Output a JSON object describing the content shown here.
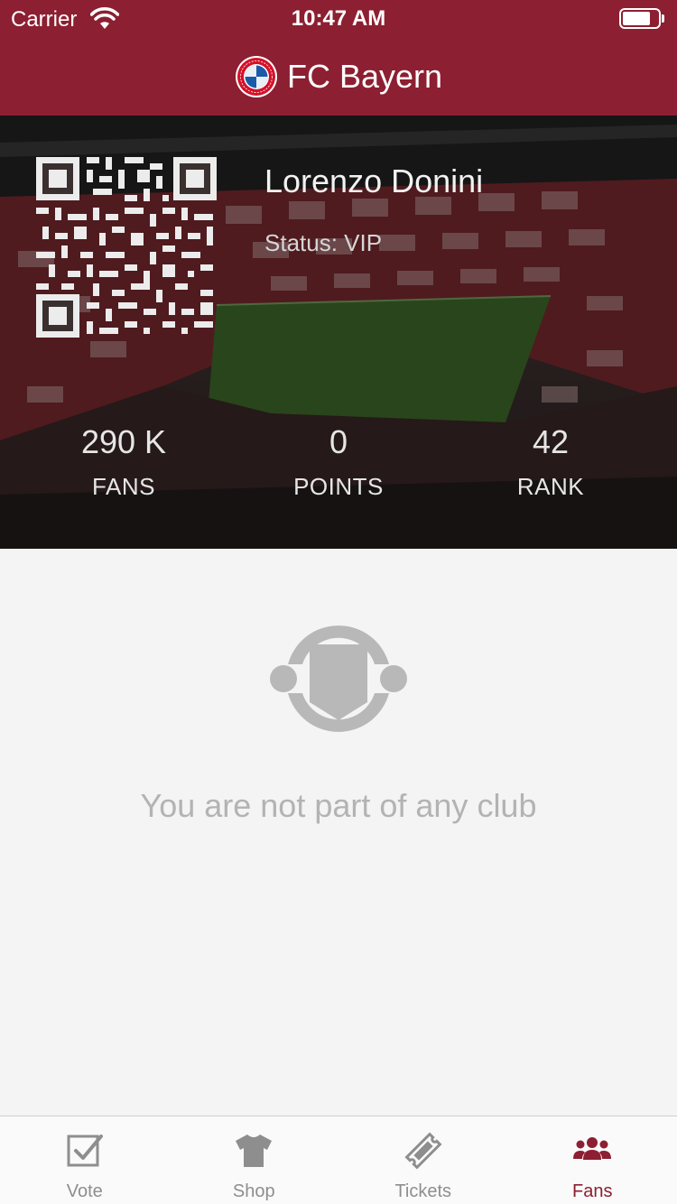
{
  "status_bar": {
    "carrier": "Carrier",
    "time": "10:47 AM"
  },
  "nav": {
    "title": "FC Bayern"
  },
  "profile": {
    "name": "Lorenzo Donini",
    "status": "Status: VIP",
    "stats": [
      {
        "value": "290 K",
        "label": "FANS"
      },
      {
        "value": "0",
        "label": "POINTS"
      },
      {
        "value": "42",
        "label": "RANK"
      }
    ]
  },
  "empty_state": {
    "message": "You are not part of any club"
  },
  "tabs": [
    {
      "label": "Vote",
      "icon": "checkbox-icon",
      "active": false
    },
    {
      "label": "Shop",
      "icon": "shirt-icon",
      "active": false
    },
    {
      "label": "Tickets",
      "icon": "ticket-icon",
      "active": false
    },
    {
      "label": "Fans",
      "icon": "fans-icon",
      "active": true
    }
  ],
  "colors": {
    "brand": "#8c1f31",
    "inactive": "#8e8e8e",
    "empty_icon": "#b8b8b8"
  }
}
